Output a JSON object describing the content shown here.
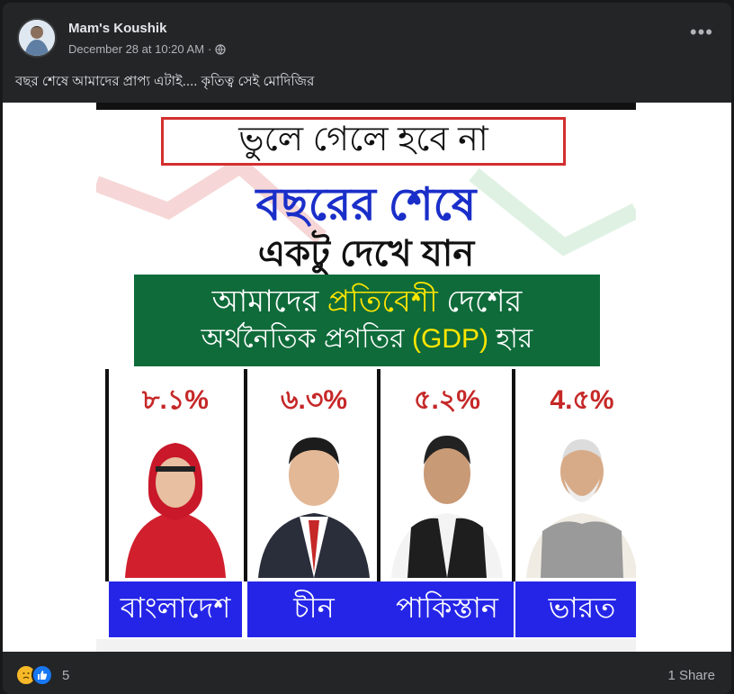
{
  "post": {
    "author": "Mam's Koushik",
    "timestamp": "December 28 at 10:20 AM",
    "separator": "·",
    "privacy_icon": "globe-icon",
    "more_icon": "more-options-icon",
    "caption": "বছর শেষে আমাদের প্রাপ্য এটাই.... কৃতিত্ব সেই মোদিজির"
  },
  "poster": {
    "banner": "ভুলে গেলে হবে না",
    "heading_line1": "বছরের শেষে",
    "heading_line2": "একটু দেখে যান",
    "green_l1_pre": "আমাদের ",
    "green_l1_highlight": "প্রতিবেশী",
    "green_l1_post": " দেশের",
    "green_l2_pre": "অর্থনৈতিক প্রগতির ",
    "green_l2_highlight": "(GDP)",
    "green_l2_post": " হার",
    "columns": [
      {
        "pct": "৮.১%",
        "name": "বাংলাদেশ"
      },
      {
        "pct": "৬.৩%",
        "name": "চীন"
      },
      {
        "pct": "৫.২%",
        "name": "পাকিস্তান"
      },
      {
        "pct": "4.৫%",
        "name": "ভারত"
      }
    ],
    "colors": {
      "pct_red": "#c62828",
      "name_blue": "#2525e8",
      "green": "#0f6b3a",
      "highlight_yellow": "#ffe600"
    }
  },
  "footer": {
    "reactions": [
      "sad-reaction-icon",
      "like-reaction-icon"
    ],
    "reaction_count": "5",
    "shares": "1 Share"
  }
}
